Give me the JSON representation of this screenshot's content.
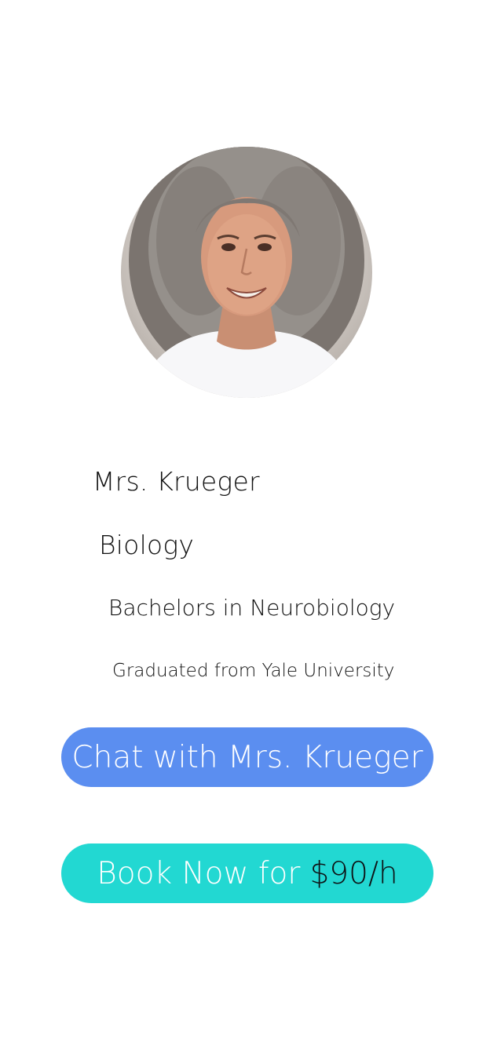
{
  "profile": {
    "name": "Mrs. Krueger",
    "subject": "Biology",
    "degree": "Bachelors in Neurobiology",
    "school": "Graduated from Yale University"
  },
  "actions": {
    "chat_label": "Chat with Mrs. Krueger",
    "book_label": "Book Now for",
    "book_price": "$90/h"
  },
  "colors": {
    "chat_button": "#5b8ef0",
    "book_button": "#22d8d2",
    "background": "#ffffff"
  },
  "icons": {
    "avatar": "teacher-portrait"
  }
}
